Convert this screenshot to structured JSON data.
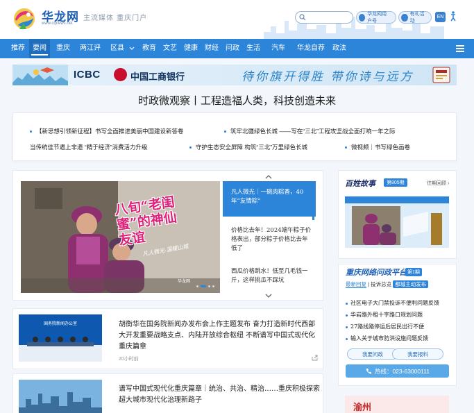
{
  "header": {
    "site_name": "华龙网",
    "site_url": "www.cqnews.net",
    "slogan": "主流媒体  重庆门户",
    "search_placeholder": "",
    "account_label": "华龙网用户号",
    "cart_label": "有礼活动",
    "lang_label": "EN"
  },
  "nav": {
    "items": [
      "推荐",
      "要闻",
      "重庆",
      "两江评",
      "区县",
      "教育",
      "文艺",
      "健康",
      "财经",
      "问政",
      "生活",
      "汽车",
      "华龙自荐",
      "政法"
    ]
  },
  "banner": {
    "brand": "ICBC",
    "bank": "中国工商银行",
    "slogan": "待你旗开得胜  带你诗与远方"
  },
  "headline": "时政微观察丨工程造福人类，科技创造未来",
  "links": [
    "【新思想引领新征程】书写全面推进美丽中国建设新答卷",
    "筑牢北疆绿色长城 ——写在“三北”工程攻坚战全面打响一年之际",
    "当传统佳节遇上非遗 “精于经济”消费活力升级",
    "守护生态安全屏障 构筑“三北”万里绿色长城",
    "微视频｜书写绿色画卷"
  ],
  "feature": {
    "photo_title": "八旬“老闺蜜”的神仙友谊",
    "photo_caption": "凡人微光·温暖山城",
    "photo_logo": "华龙网",
    "side_items": [
      "凡人微光｜一碗肉粽香，40年“友情粽”",
      "价格比去年！2024端午粽子价格表出，部分粽子价格比去年低了",
      "西瓜价格跳水！低至几毛钱一斤，这样挑瓜不踩坑"
    ]
  },
  "news": [
    {
      "title": "胡衡华在国务院新闻办发布会上作主题发布 奋力打造新时代西部大开发重要战略支点、内陆开放综合枢纽 不断谱写中国式现代化重庆篇章",
      "time": "20小时前",
      "thumb_text": "国务院新闻办公室"
    },
    {
      "title": "谱写中国式现代化重庆篇章｜统治、共治、精治……重庆积极探索超大城市现代化治理新路子",
      "time": "",
      "thumb_text": ""
    }
  ],
  "right": {
    "story_logo": "百姓故事",
    "story_badge": "第805期",
    "more_label": "往期回顾 ›",
    "wz_logo": "重庆网络问政平台",
    "wz_badge": "第1期",
    "wz_tabs": [
      "最新回复",
      "投诉总览",
      "都城主动发布"
    ],
    "wz_items": [
      "社区电子大门禁投诉不便利问题反馈",
      "华岩路外租十字路口规划问题",
      "27路线路停运后居民出行不便",
      "输入关于城市防洪设施问题反馈"
    ],
    "ask_label": "我要问政",
    "report_label": "我要报料",
    "hotline": "热线：023-63000111",
    "bottom_text": "渝州"
  }
}
